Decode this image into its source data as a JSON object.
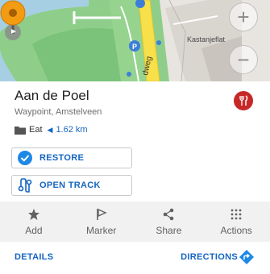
{
  "map": {
    "label_kastanjeflat": "Kastanjeflat",
    "road_label": "dweg",
    "zoom_in": "+",
    "zoom_out": "−"
  },
  "place": {
    "title": "Aan de Poel",
    "subtitle": "Waypoint, Amstelveen",
    "category": "Eat",
    "distance": "1.62 km",
    "direction_arrow": "◀"
  },
  "buttons": {
    "restore": "RESTORE",
    "open_track": "OPEN TRACK"
  },
  "actions": [
    {
      "label": "Add",
      "icon": "star-icon"
    },
    {
      "label": "Marker",
      "icon": "flag-icon"
    },
    {
      "label": "Share",
      "icon": "share-icon"
    },
    {
      "label": "Actions",
      "icon": "grid-icon"
    }
  ],
  "footer": {
    "details": "DETAILS",
    "directions": "DIRECTIONS"
  },
  "colors": {
    "accent": "#1565c0",
    "marker": "#f39c12",
    "eat_badge": "#c62828"
  }
}
